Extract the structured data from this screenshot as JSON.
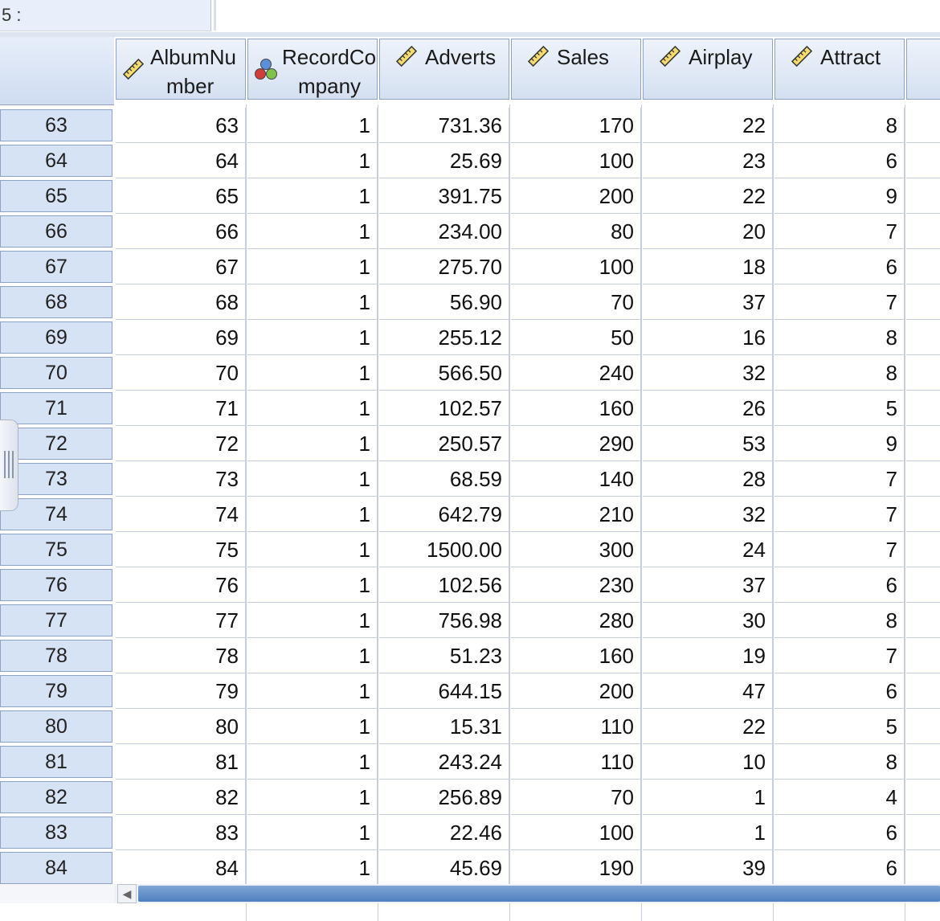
{
  "cell_editor": {
    "reference": "5 :",
    "value": ""
  },
  "columns": [
    {
      "key": "albumnumber",
      "line1": "AlbumNu",
      "line2": "mber",
      "icon": "scale-ruler-icon"
    },
    {
      "key": "recordcompany",
      "line1": "RecordCo",
      "line2": "mpany",
      "icon": "nominal-balls-icon"
    },
    {
      "key": "adverts",
      "line1": "Adverts",
      "line2": "",
      "icon": "scale-ruler-icon"
    },
    {
      "key": "sales",
      "line1": "Sales",
      "line2": "",
      "icon": "scale-ruler-icon"
    },
    {
      "key": "airplay",
      "line1": "Airplay",
      "line2": "",
      "icon": "scale-ruler-icon"
    },
    {
      "key": "attract",
      "line1": "Attract",
      "line2": "",
      "icon": "scale-ruler-icon"
    }
  ],
  "rows": [
    {
      "row": "63",
      "cells": [
        "63",
        "1",
        "731.36",
        "170",
        "22",
        "8"
      ]
    },
    {
      "row": "64",
      "cells": [
        "64",
        "1",
        "25.69",
        "100",
        "23",
        "6"
      ]
    },
    {
      "row": "65",
      "cells": [
        "65",
        "1",
        "391.75",
        "200",
        "22",
        "9"
      ]
    },
    {
      "row": "66",
      "cells": [
        "66",
        "1",
        "234.00",
        "80",
        "20",
        "7"
      ]
    },
    {
      "row": "67",
      "cells": [
        "67",
        "1",
        "275.70",
        "100",
        "18",
        "6"
      ]
    },
    {
      "row": "68",
      "cells": [
        "68",
        "1",
        "56.90",
        "70",
        "37",
        "7"
      ]
    },
    {
      "row": "69",
      "cells": [
        "69",
        "1",
        "255.12",
        "50",
        "16",
        "8"
      ]
    },
    {
      "row": "70",
      "cells": [
        "70",
        "1",
        "566.50",
        "240",
        "32",
        "8"
      ]
    },
    {
      "row": "71",
      "cells": [
        "71",
        "1",
        "102.57",
        "160",
        "26",
        "5"
      ]
    },
    {
      "row": "72",
      "cells": [
        "72",
        "1",
        "250.57",
        "290",
        "53",
        "9"
      ]
    },
    {
      "row": "73",
      "cells": [
        "73",
        "1",
        "68.59",
        "140",
        "28",
        "7"
      ]
    },
    {
      "row": "74",
      "cells": [
        "74",
        "1",
        "642.79",
        "210",
        "32",
        "7"
      ]
    },
    {
      "row": "75",
      "cells": [
        "75",
        "1",
        "1500.00",
        "300",
        "24",
        "7"
      ]
    },
    {
      "row": "76",
      "cells": [
        "76",
        "1",
        "102.56",
        "230",
        "37",
        "6"
      ]
    },
    {
      "row": "77",
      "cells": [
        "77",
        "1",
        "756.98",
        "280",
        "30",
        "8"
      ]
    },
    {
      "row": "78",
      "cells": [
        "78",
        "1",
        "51.23",
        "160",
        "19",
        "7"
      ]
    },
    {
      "row": "79",
      "cells": [
        "79",
        "1",
        "644.15",
        "200",
        "47",
        "6"
      ]
    },
    {
      "row": "80",
      "cells": [
        "80",
        "1",
        "15.31",
        "110",
        "22",
        "5"
      ]
    },
    {
      "row": "81",
      "cells": [
        "81",
        "1",
        "243.24",
        "110",
        "10",
        "8"
      ]
    },
    {
      "row": "82",
      "cells": [
        "82",
        "1",
        "256.89",
        "70",
        "1",
        "4"
      ]
    },
    {
      "row": "83",
      "cells": [
        "83",
        "1",
        "22.46",
        "100",
        "1",
        "6"
      ]
    },
    {
      "row": "84",
      "cells": [
        "84",
        "1",
        "45.69",
        "190",
        "39",
        "6"
      ]
    }
  ],
  "colors": {
    "header_bg": "#d4e0f1",
    "row_header_bg": "#d6e3f5",
    "grid_line": "#c6d0de",
    "scroll_thumb": "#4f7fbe"
  }
}
